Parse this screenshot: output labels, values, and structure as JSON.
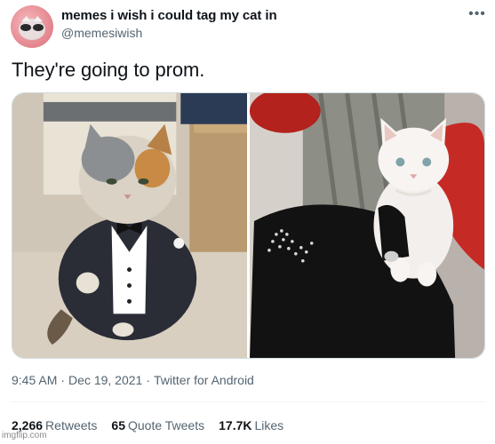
{
  "tweet": {
    "author": {
      "display_name": "memes i wish i could tag my cat in",
      "handle": "@memesiwish"
    },
    "more_icon": "more-horizontal-icon",
    "text": "They're going to prom.",
    "media": [
      {
        "name": "cat-in-tuxedo"
      },
      {
        "name": "cat-in-dress"
      }
    ],
    "meta": {
      "time": "9:45 AM",
      "date": "Dec 19, 2021",
      "source": "Twitter for Android",
      "separator": "·"
    },
    "stats": {
      "retweets": {
        "count": "2,266",
        "label": "Retweets"
      },
      "quote_tweets": {
        "count": "65",
        "label": "Quote Tweets"
      },
      "likes": {
        "count": "17.7K",
        "label": "Likes"
      }
    }
  },
  "watermark": "imgflip.com",
  "colors": {
    "text": "#0f1419",
    "secondary": "#536471",
    "avatar": "#e3848c",
    "divider": "#eff3f4"
  }
}
